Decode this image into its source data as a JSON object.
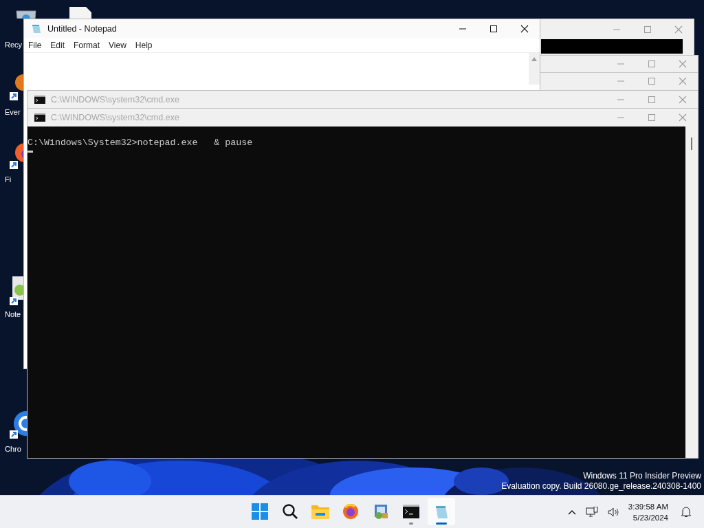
{
  "desktop": {
    "icons": [
      {
        "kind": "recycle-bin",
        "label": "Recy"
      },
      {
        "kind": "document"
      },
      {
        "kind": "evernote",
        "label": "Ever"
      },
      {
        "kind": "firefox",
        "label": "Fi"
      },
      {
        "kind": "notepad",
        "label": "Note"
      },
      {
        "kind": "chrome",
        "label": "Chro"
      }
    ],
    "watermark": [
      "Windows 11 Pro Insider Preview",
      "Evaluation copy. Build 26080.ge_release.240308-1400"
    ]
  },
  "notepad": {
    "title": "Untitled - Notepad",
    "active": true,
    "menu": [
      "File",
      "Edit",
      "Format",
      "View",
      "Help"
    ]
  },
  "cmd_windows": [
    {
      "title": "C:\\WINDOWS\\system32\\cmd.exe",
      "active": false
    },
    {
      "title": "C:\\WINDOWS\\system32\\cmd.exe",
      "active": false,
      "lines": [
        "C:\\Windows\\System32>notepad.exe   & pause"
      ]
    }
  ],
  "taskbar": {
    "apps": [
      {
        "kind": "start",
        "running": false,
        "selected": false
      },
      {
        "kind": "search",
        "running": false,
        "selected": false
      },
      {
        "kind": "explorer",
        "running": false,
        "selected": false
      },
      {
        "kind": "firefox",
        "running": false,
        "selected": false
      },
      {
        "kind": "setup",
        "running": false,
        "selected": false
      },
      {
        "kind": "cmd",
        "running": true,
        "selected": false
      },
      {
        "kind": "notepad",
        "running": true,
        "selected": true
      }
    ],
    "clock": {
      "time": "3:39:58 AM",
      "date": "5/23/2024"
    }
  }
}
